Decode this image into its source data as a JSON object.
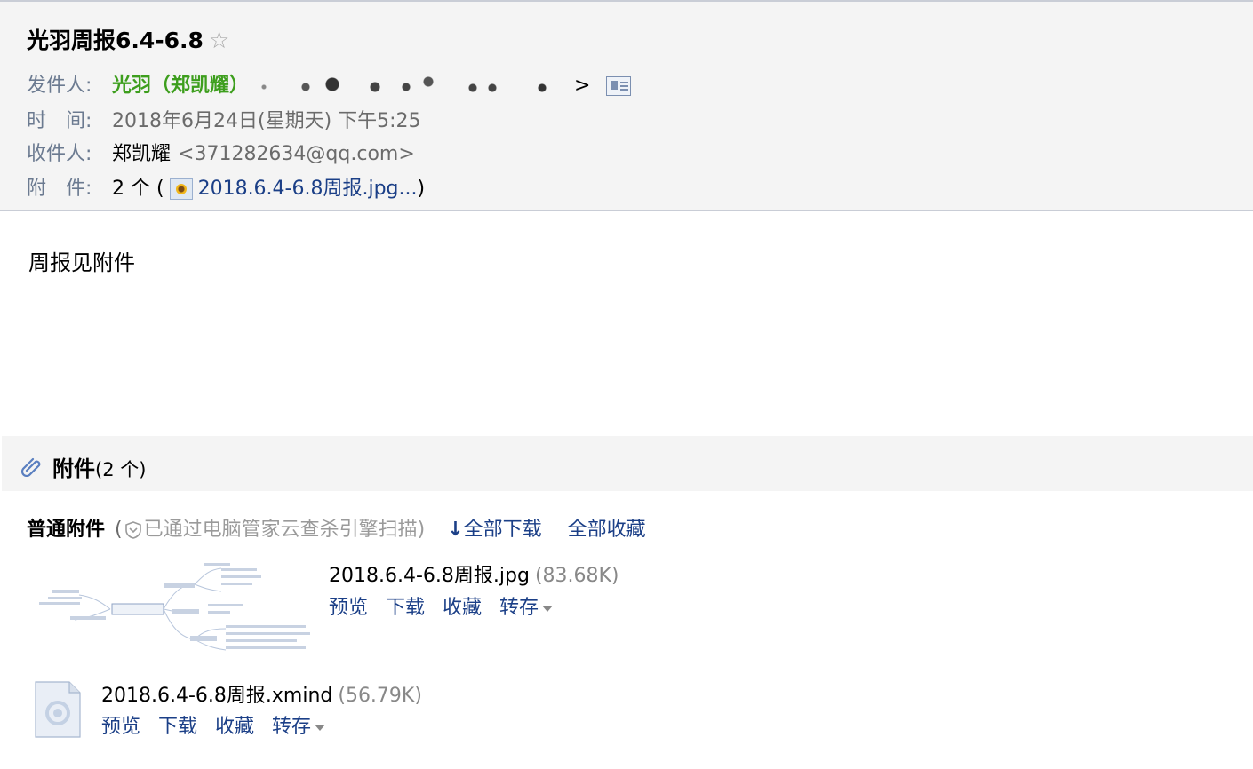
{
  "header": {
    "subject": "光羽周报6.4-6.8",
    "star_icon": "☆",
    "from_label": "发件人:",
    "from_name": "光羽（郑凯耀）",
    "from_open": "<",
    "from_close": ">",
    "time_label": "时　间:",
    "time_value": "2018年6月24日(星期天) 下午5:25",
    "to_label": "收件人:",
    "to_name": "郑凯耀",
    "to_email": "<371282634@qq.com>",
    "att_label": "附　件:",
    "att_count": "2 个 (",
    "att_link": "2018.6.4-6.8周报.jpg...",
    "att_close": ")"
  },
  "body": {
    "text": "周报见附件"
  },
  "attachments": {
    "title": "附件",
    "count": "(2 个)",
    "normal_label": "普通附件",
    "scan_open": "(",
    "scan_text": "已通过电脑管家云查杀引擎扫描",
    "scan_close": ")",
    "download_all": "全部下载",
    "collect_all": "全部收藏",
    "files": [
      {
        "name": "2018.6.4-6.8周报.jpg",
        "size": "(83.68K)",
        "actions": [
          "预览",
          "下载",
          "收藏",
          "转存"
        ]
      },
      {
        "name": "2018.6.4-6.8周报.xmind",
        "size": "(56.79K)",
        "actions": [
          "预览",
          "下载",
          "收藏",
          "转存"
        ]
      }
    ]
  },
  "colors": {
    "header_bg": "#f4f4f4",
    "label": "#6b7a90",
    "sender": "#3d9e1d",
    "link": "#1b3f87",
    "muted": "#888888"
  }
}
